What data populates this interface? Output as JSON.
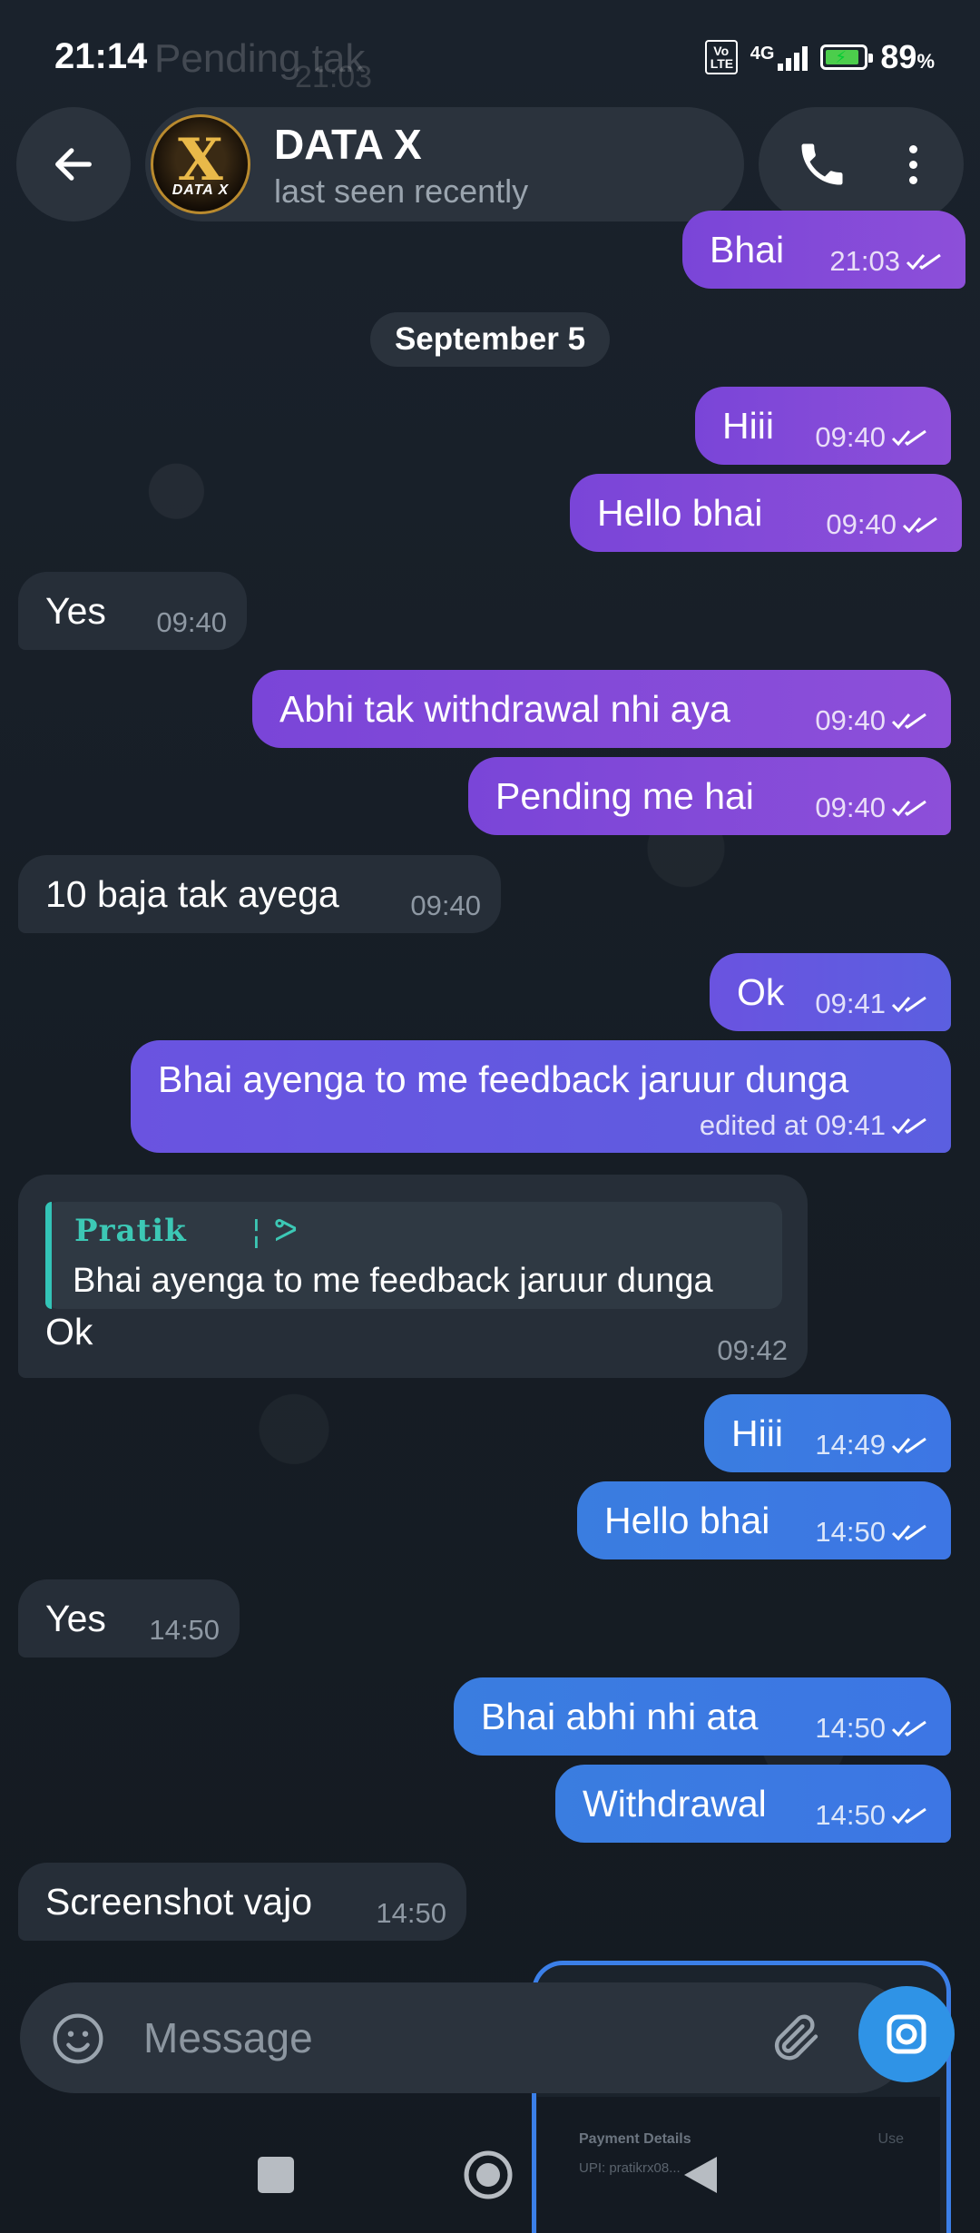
{
  "status_bar": {
    "time": "21:14",
    "network": "4G",
    "volte": "Vo LTE",
    "battery_percent": "89",
    "battery_unit": "%",
    "battery_level": 0.89,
    "ghost_preview_text": "Pending tak",
    "ghost_preview_time": "21:03"
  },
  "header": {
    "avatar_mark": "X",
    "avatar_brand": "DATA X",
    "chat_name": "DATA X",
    "chat_status": "last seen recently",
    "call_icon": "phone-icon",
    "more_icon": "more-vertical-icon"
  },
  "colors": {
    "outgoing_purple": "#8a4cdb",
    "outgoing_indigo": "#5f5ae0",
    "outgoing_blue": "#3b7ae2",
    "incoming": "#262e38",
    "reply_accent": "#33c4b7"
  },
  "date_separator": "September 5",
  "messages": [
    {
      "text": "Bhai",
      "time": "21:03",
      "direction": "out",
      "read": true
    },
    {
      "text": "Hiii",
      "time": "09:40",
      "direction": "out",
      "read": true
    },
    {
      "text": "Hello bhai",
      "time": "09:40",
      "direction": "out",
      "read": true
    },
    {
      "text": "Yes",
      "time": "09:40",
      "direction": "in"
    },
    {
      "text": "Abhi tak withdrawal nhi aya",
      "time": "09:40",
      "direction": "out",
      "read": true
    },
    {
      "text": "Pending me hai",
      "time": "09:40",
      "direction": "out",
      "read": true
    },
    {
      "text": "10 baja tak ayega",
      "time": "09:40",
      "direction": "in"
    },
    {
      "text": "Ok",
      "time": "09:41",
      "direction": "out",
      "read": true
    },
    {
      "text": "Bhai ayenga to me feedback jaruur dunga",
      "time": "edited at 09:41",
      "direction": "out",
      "read": true
    },
    {
      "text": "Ok",
      "time": "09:42",
      "direction": "in",
      "reply_to": {
        "name": "Pratik",
        "text": "Bhai ayenga to me feedback jaruur dunga"
      }
    },
    {
      "text": "Hiii",
      "time": "14:49",
      "direction": "out",
      "read": true
    },
    {
      "text": "Hello bhai",
      "time": "14:50",
      "direction": "out",
      "read": true
    },
    {
      "text": "Yes",
      "time": "14:50",
      "direction": "in"
    },
    {
      "text": "Bhai abhi nhi ata",
      "time": "14:50",
      "direction": "out",
      "read": true
    },
    {
      "text": "Withdrawal",
      "time": "14:50",
      "direction": "out",
      "read": true
    },
    {
      "text": "Screenshot vajo",
      "time": "14:50",
      "direction": "in"
    }
  ],
  "composer": {
    "placeholder": "Message",
    "emoji_icon": "emoji-icon",
    "attach_icon": "paperclip-icon",
    "camera_icon": "camera-icon"
  },
  "image_preview": {
    "title": "Payment Details",
    "action": "Use",
    "upi": "UPI: pratikrx08..."
  },
  "nav_bar": {
    "recents_icon": "square-icon",
    "home_icon": "circle-home-icon",
    "back_icon": "triangle-back-icon"
  }
}
